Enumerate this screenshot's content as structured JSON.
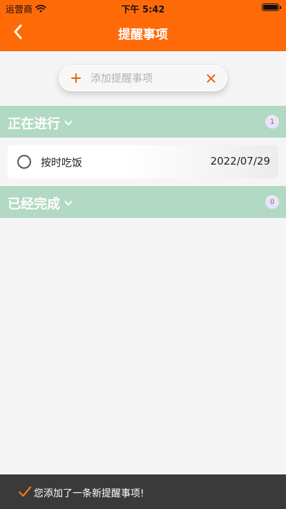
{
  "status_bar": {
    "carrier": "运营商",
    "time": "下午 5:42"
  },
  "nav": {
    "title": "提醒事项"
  },
  "add_bar": {
    "placeholder": "添加提醒事项",
    "plus_icon": "plus-icon",
    "clear_icon": "close-icon"
  },
  "sections": {
    "in_progress": {
      "title": "正在进行",
      "count": "1",
      "items": [
        {
          "name": "按时吃饭",
          "date": "2022/07/29",
          "done": false
        }
      ]
    },
    "completed": {
      "title": "已经完成",
      "count": "0",
      "items": []
    }
  },
  "toast": {
    "message": "您添加了一条新提醒事项!"
  },
  "colors": {
    "header": "#ff6a08",
    "section_header": "#b2d9c3",
    "accent_icon": "#e8620a",
    "toast_bg": "#3a3a3a"
  }
}
